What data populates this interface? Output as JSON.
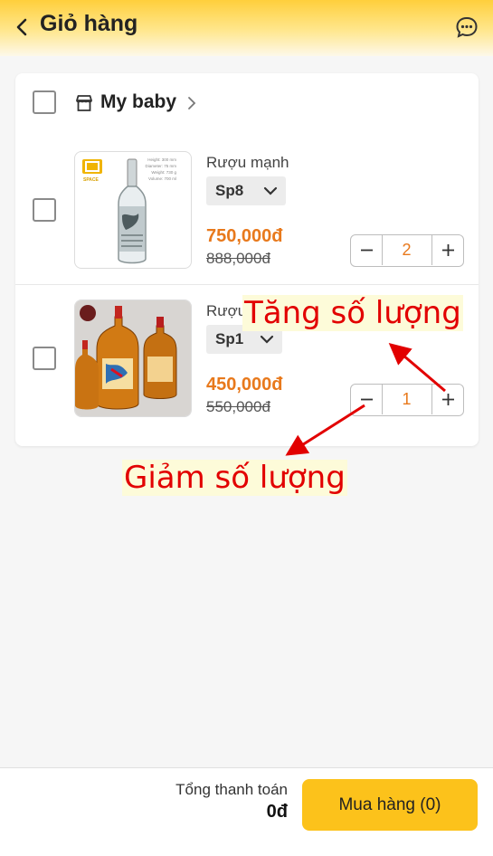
{
  "header": {
    "title": "Giỏ hàng"
  },
  "shop": {
    "name": "My baby"
  },
  "items": [
    {
      "name": "Rượu mạnh",
      "variant": "Sp8",
      "price": "750,000đ",
      "old_price": "888,000đ",
      "quantity": "2",
      "thumb_specs": [
        "Height: 300 mm",
        "Diameter: 75 mm",
        "Weight: 730 g",
        "Volume: 700 ml"
      ],
      "thumb_brand": "SPACE"
    },
    {
      "name": "Rượu mạnh",
      "variant": "Sp1",
      "price": "450,000đ",
      "old_price": "550,000đ",
      "quantity": "1"
    }
  ],
  "annotations": {
    "increase": "Tăng số lượng",
    "decrease": "Giảm số lượng"
  },
  "footer": {
    "total_label": "Tổng thanh toán",
    "total_value": "0đ",
    "buy_label": "Mua hàng (0)"
  },
  "colors": {
    "accent": "#fcc21b",
    "price": "#e8791c",
    "annotation": "#e20000"
  }
}
